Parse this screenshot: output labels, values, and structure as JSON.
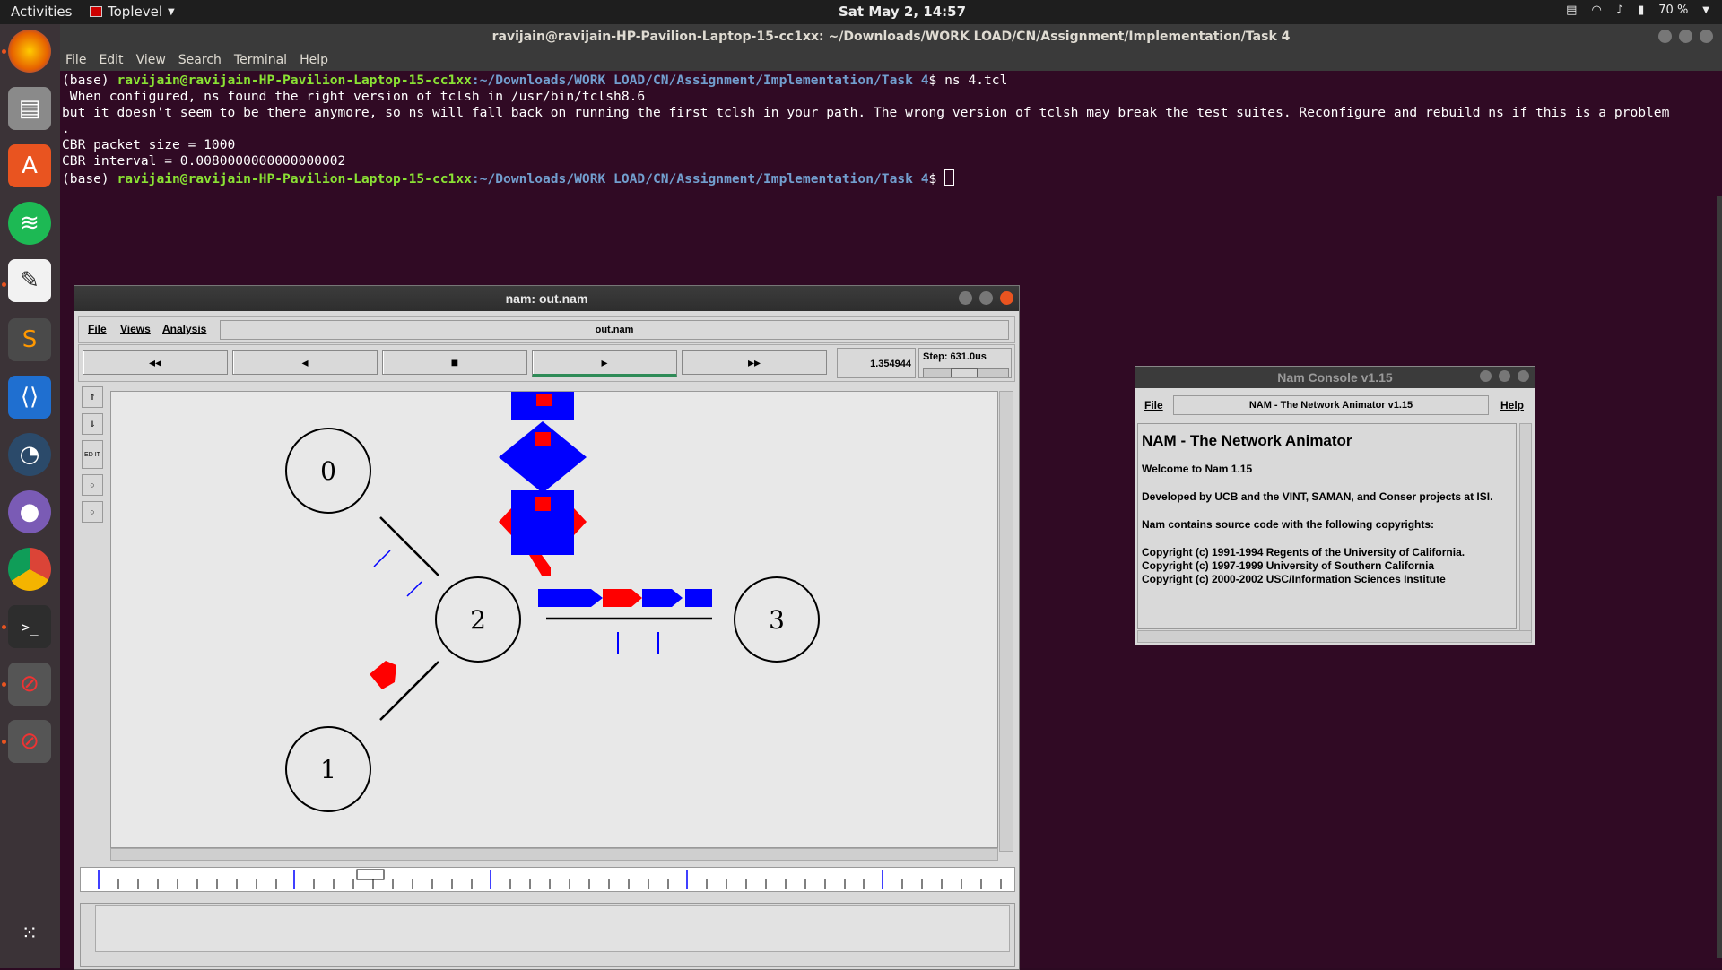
{
  "topbar": {
    "activities": "Activities",
    "app_menu": "Toplevel",
    "clock": "Sat May  2, 14:57",
    "battery": "70 %"
  },
  "terminal": {
    "title": "ravijain@ravijain-HP-Pavilion-Laptop-15-cc1xx: ~/Downloads/WORK LOAD/CN/Assignment/Implementation/Task 4",
    "menu": [
      "File",
      "Edit",
      "View",
      "Search",
      "Terminal",
      "Help"
    ],
    "prompt_env": "(base) ",
    "prompt_user": "ravijain@ravijain-HP-Pavilion-Laptop-15-cc1xx",
    "prompt_path": ":~/Downloads/WORK LOAD/CN/Assignment/Implementation/Task 4",
    "command": "$ ns 4.tcl",
    "out1": " When configured, ns found the right version of tclsh in /usr/bin/tclsh8.6",
    "out2": "but it doesn't seem to be there anymore, so ns will fall back on running the first tclsh in your path. The wrong version of tclsh may break the test suites. Reconfigure and rebuild ns if this is a problem",
    "out3": ".",
    "out4": "CBR packet size = 1000",
    "out5": "CBR interval = 0.0080000000000000002",
    "prompt_end": "$ "
  },
  "nam": {
    "title": "nam: out.nam",
    "menu": [
      "File",
      "Views",
      "Analysis"
    ],
    "filename": "out.nam",
    "buttons": [
      "◂◂",
      "◂",
      "■",
      "▸",
      "▸▸"
    ],
    "time": "1.354944",
    "step": "Step: 631.0us",
    "tools": [
      "⇑",
      "⇓",
      "ED IT",
      "○",
      "○"
    ],
    "nodes": [
      "0",
      "1",
      "2",
      "3"
    ]
  },
  "console": {
    "title": "Nam Console v1.15",
    "menu_file": "File",
    "menu_help": "Help",
    "banner": "NAM - The Network Animator v1.15",
    "heading": "NAM - The Network Animator",
    "welcome": "Welcome to Nam 1.15",
    "developed": "Developed by UCB and the VINT, SAMAN, and Conser projects at ISI.",
    "contains": "Nam contains source code with the following copyrights:",
    "copyrights": [
      "Copyright (c) 1991-1994 Regents of the University of California.",
      "Copyright (c) 1997-1999 University of Southern California",
      "Copyright (c) 2000-2002 USC/Information Sciences Institute"
    ]
  },
  "dock": [
    "firefox-icon",
    "files-icon",
    "software-icon",
    "spotify-icon",
    "text-editor-icon",
    "sublime-icon",
    "vscode-icon",
    "gauge-icon",
    "github-icon",
    "chrome-icon",
    "terminal-icon",
    "nam-window-icon",
    "nam-console-icon",
    "app-grid-icon"
  ],
  "colors": {
    "packet_blue": "#0000ff",
    "packet_red": "#ff0000",
    "accent": "#e95420"
  }
}
